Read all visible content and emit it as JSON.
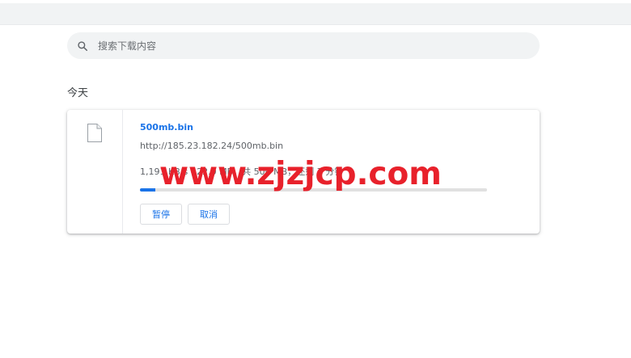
{
  "search": {
    "placeholder": "搜索下载内容",
    "icon": "search-icon"
  },
  "section": {
    "label": "今天"
  },
  "download": {
    "file_name": "500mb.bin",
    "url": "http://185.23.182.24/500mb.bin",
    "status": "1,191 KB/s - 22.0 MB，共 500 MB，还剩 7 分钟",
    "progress_fraction": 0.044,
    "file_icon": "file-icon",
    "pause_label": "暂停",
    "cancel_label": "取消"
  },
  "watermark": {
    "text": "www.zjzjcp.com"
  },
  "colors": {
    "accent": "#1a73e8",
    "watermark": "#e8212b",
    "toolbar_bg": "#f1f3f4"
  }
}
